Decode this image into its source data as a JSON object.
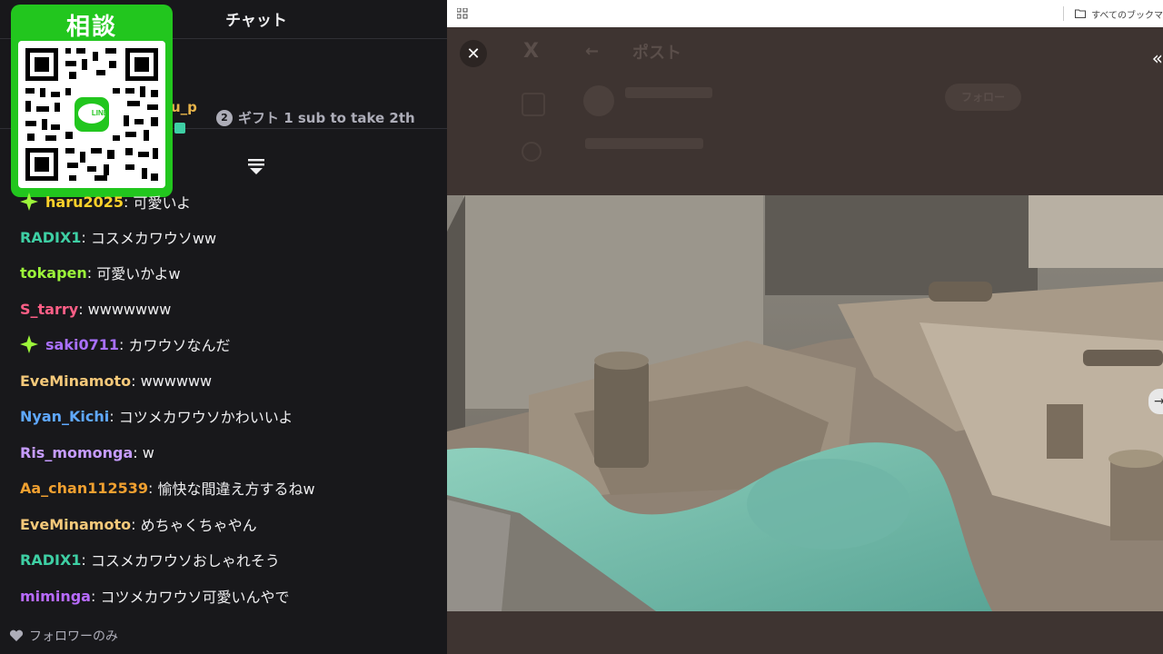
{
  "chat": {
    "header_title": "チャット",
    "pinned": {
      "user_fragment": "u_p",
      "gift_number": "2",
      "gift_text": "ギフト 1 sub to take 2th"
    },
    "qr_overlay": {
      "title": "相談",
      "logo_text": "LINE"
    },
    "messages": [
      {
        "user": "haru2025",
        "text": "可愛いよ",
        "color": "#fcd12a",
        "badge": "sparkle-icon"
      },
      {
        "user": "RADIX1",
        "text": "コスメカワウソww",
        "color": "#3ecfa4"
      },
      {
        "user": "tokapen",
        "text": "可愛いかよw",
        "color": "#9cf53a"
      },
      {
        "user": "S_tarry",
        "text": "wwwwwww",
        "color": "#ff5f87"
      },
      {
        "user": "saki0711",
        "text": "カワウソなんだ",
        "color": "#a970ff",
        "badge": "sparkle-icon"
      },
      {
        "user": "EveMinamoto",
        "text": "wwwwww",
        "color": "#f5c97a"
      },
      {
        "user": "Nyan_Kichi",
        "text": "コツメカワウソかわいいよ",
        "color": "#5fa8ff"
      },
      {
        "user": "Ris_momonga",
        "text": "w",
        "color": "#c69cff"
      },
      {
        "user": "Aa_chan112539",
        "text": "愉快な間違え方するねw",
        "color": "#f0a030"
      },
      {
        "user": "EveMinamoto",
        "text": "めちゃくちゃやん",
        "color": "#f5c97a"
      },
      {
        "user": "RADIX1",
        "text": "コスメカワウソおしゃれそう",
        "color": "#3ecfa4"
      },
      {
        "user": "miminga",
        "text": "コツメカワウソ可愛いんやで",
        "color": "#b86bff"
      }
    ],
    "footer_text": "フォロワーのみ"
  },
  "browser": {
    "bookmarks_label": "すべてのブックマ"
  },
  "viewer": {
    "close_symbol": "✕",
    "ghost_title": "ポスト",
    "ghost_x": "X",
    "ghost_back": "←",
    "ghost_follow": "フォロー",
    "media_description": "otter enclosure with pool"
  },
  "colors": {
    "chat_bg": "#18181b",
    "viewer_bg": "#3e3431",
    "line_green": "#22c61e"
  }
}
